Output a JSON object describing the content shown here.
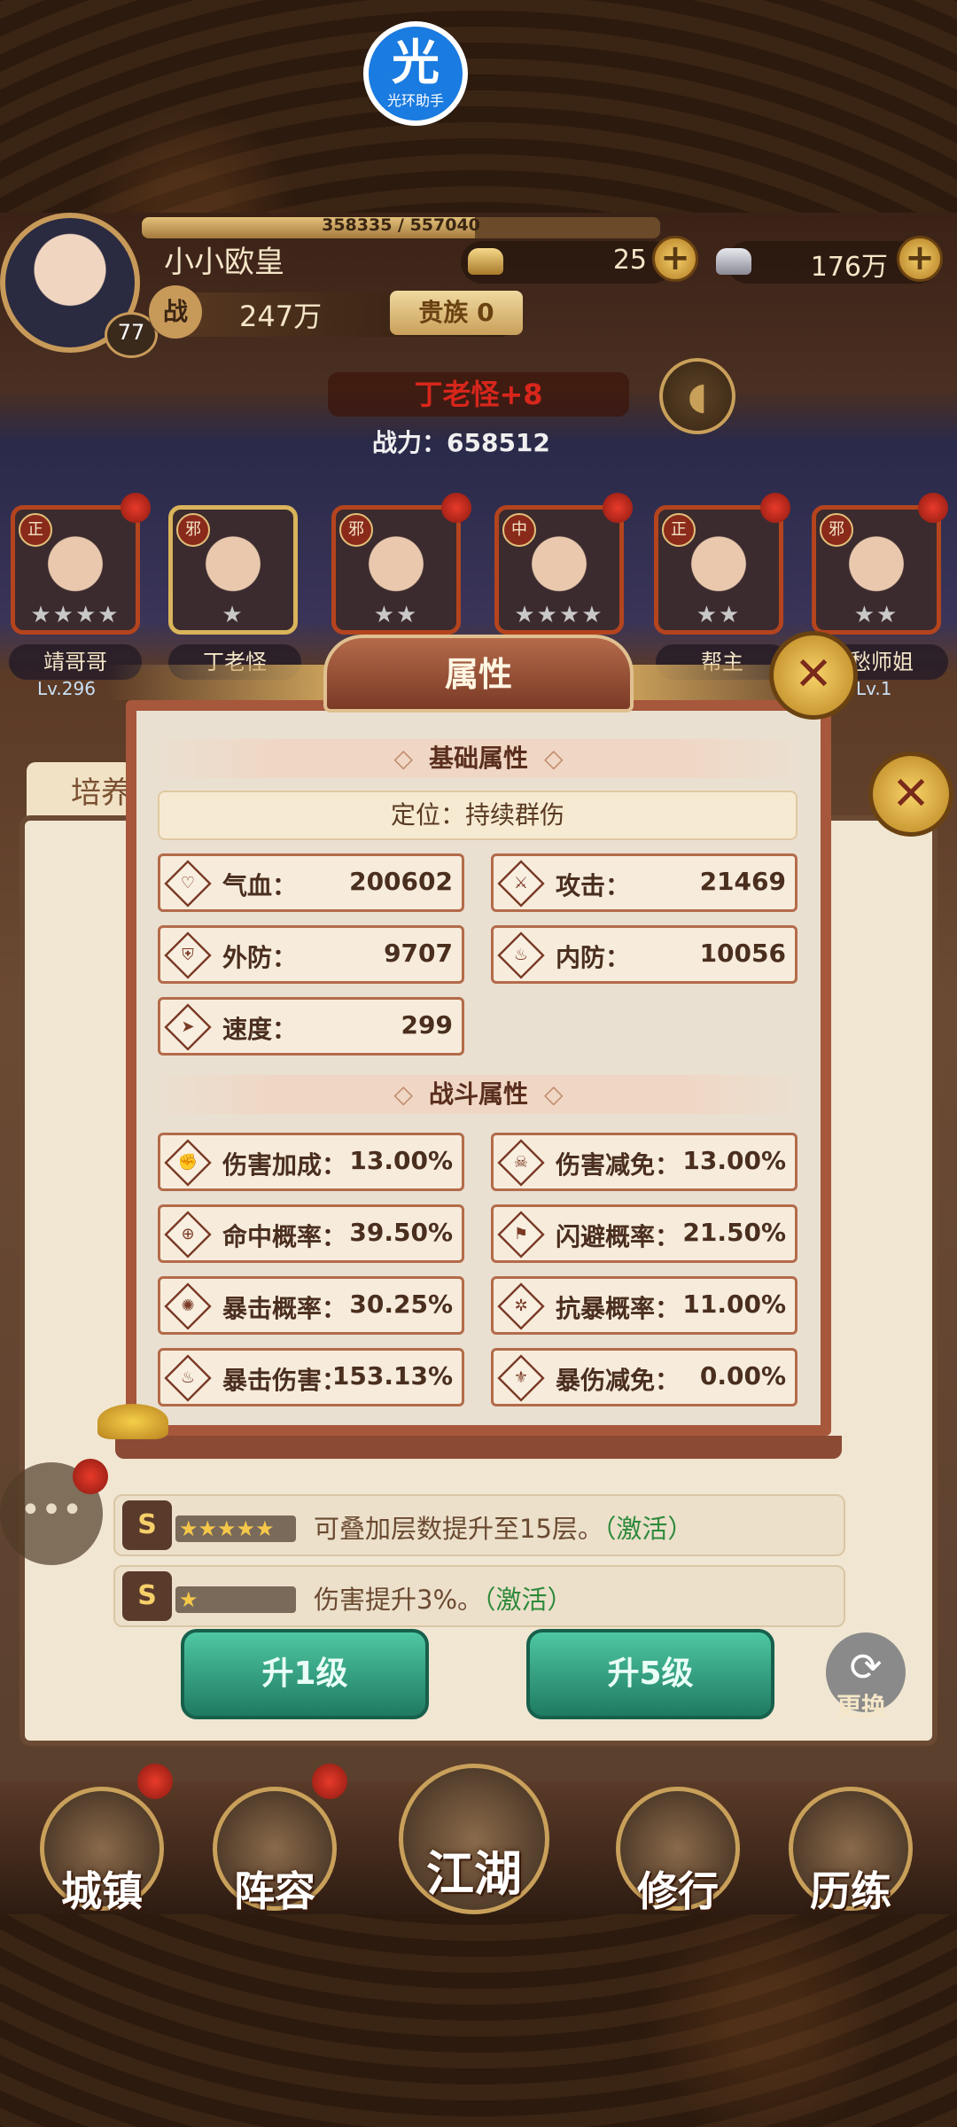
{
  "app_badge": {
    "glyph": "光",
    "label": "光环助手"
  },
  "header": {
    "exp_text": "358335 / 557040",
    "exp_progress": 0.643,
    "level": "77",
    "player_name": "小小欧皇",
    "gold_value": "25",
    "silver_value": "176万",
    "power_glyph": "战",
    "power_value": "247万",
    "noble_label": "贵族 0"
  },
  "boss": {
    "name": "丁老怪+8",
    "power_text": "战力：658512"
  },
  "heroes": [
    {
      "tag": "正",
      "stars": "★★★★",
      "name": "靖哥哥",
      "level": "Lv.296"
    },
    {
      "tag": "邪",
      "stars": "★",
      "name": "丁老怪",
      "level": ""
    },
    {
      "tag": "邪",
      "stars": "★★",
      "name": "",
      "level": ""
    },
    {
      "tag": "中",
      "stars": "★★★★",
      "name": "",
      "level": ""
    },
    {
      "tag": "正",
      "stars": "★★",
      "name": "帮主",
      "level": ""
    },
    {
      "tag": "邪",
      "stars": "★★",
      "name": "愁师姐",
      "level": "Lv.1"
    }
  ],
  "bg_panel": {
    "tab_label": "培养",
    "skills": [
      {
        "stars": "★★★★★",
        "desc": "可叠加层数提升至15层。",
        "status": "（激活）"
      },
      {
        "stars": "★",
        "desc": "伤害提升3%。",
        "status": "（激活）"
      }
    ],
    "upgrade_1": "升1级",
    "upgrade_5": "升5级",
    "swap_label": "更换"
  },
  "modal": {
    "title": "属性",
    "basic_header": "基础属性",
    "role": "定位：持续群伤",
    "combat_header": "战斗属性",
    "basic_stats": [
      {
        "icon": "heart-icon",
        "glyph": "♡",
        "label": "气血：",
        "value": "200602"
      },
      {
        "icon": "sword-icon",
        "glyph": "⚔",
        "label": "攻击：",
        "value": "21469"
      },
      {
        "icon": "shield-icon",
        "glyph": "⛨",
        "label": "外防：",
        "value": "9707"
      },
      {
        "icon": "flame-icon",
        "glyph": "♨",
        "label": "内防：",
        "value": "10056"
      },
      {
        "icon": "wing-icon",
        "glyph": "➤",
        "label": "速度：",
        "value": "299"
      }
    ],
    "combat_stats": [
      {
        "icon": "fist-icon",
        "glyph": "✊",
        "label": "伤害加成：",
        "value": "13.00%"
      },
      {
        "icon": "skull-icon",
        "glyph": "☠",
        "label": "伤害减免：",
        "value": "13.00%"
      },
      {
        "icon": "target-icon",
        "glyph": "⊕",
        "label": "命中概率：",
        "value": "39.50%"
      },
      {
        "icon": "dodge-icon",
        "glyph": "⚑",
        "label": "闪避概率：",
        "value": "21.50%"
      },
      {
        "icon": "crit-icon",
        "glyph": "✺",
        "label": "暴击概率：",
        "value": "30.25%"
      },
      {
        "icon": "anticrit-icon",
        "glyph": "✲",
        "label": "抗暴概率：",
        "value": "11.00%"
      },
      {
        "icon": "critdmg-icon",
        "glyph": "♨",
        "label": "暴击伤害：",
        "value": "153.13%"
      },
      {
        "icon": "critreduce-icon",
        "glyph": "⚜",
        "label": "暴伤减免：",
        "value": "0.00%"
      }
    ]
  },
  "nav": [
    {
      "label": "城镇"
    },
    {
      "label": "阵容"
    },
    {
      "label": "江湖"
    },
    {
      "label": "修行"
    },
    {
      "label": "历练"
    }
  ]
}
